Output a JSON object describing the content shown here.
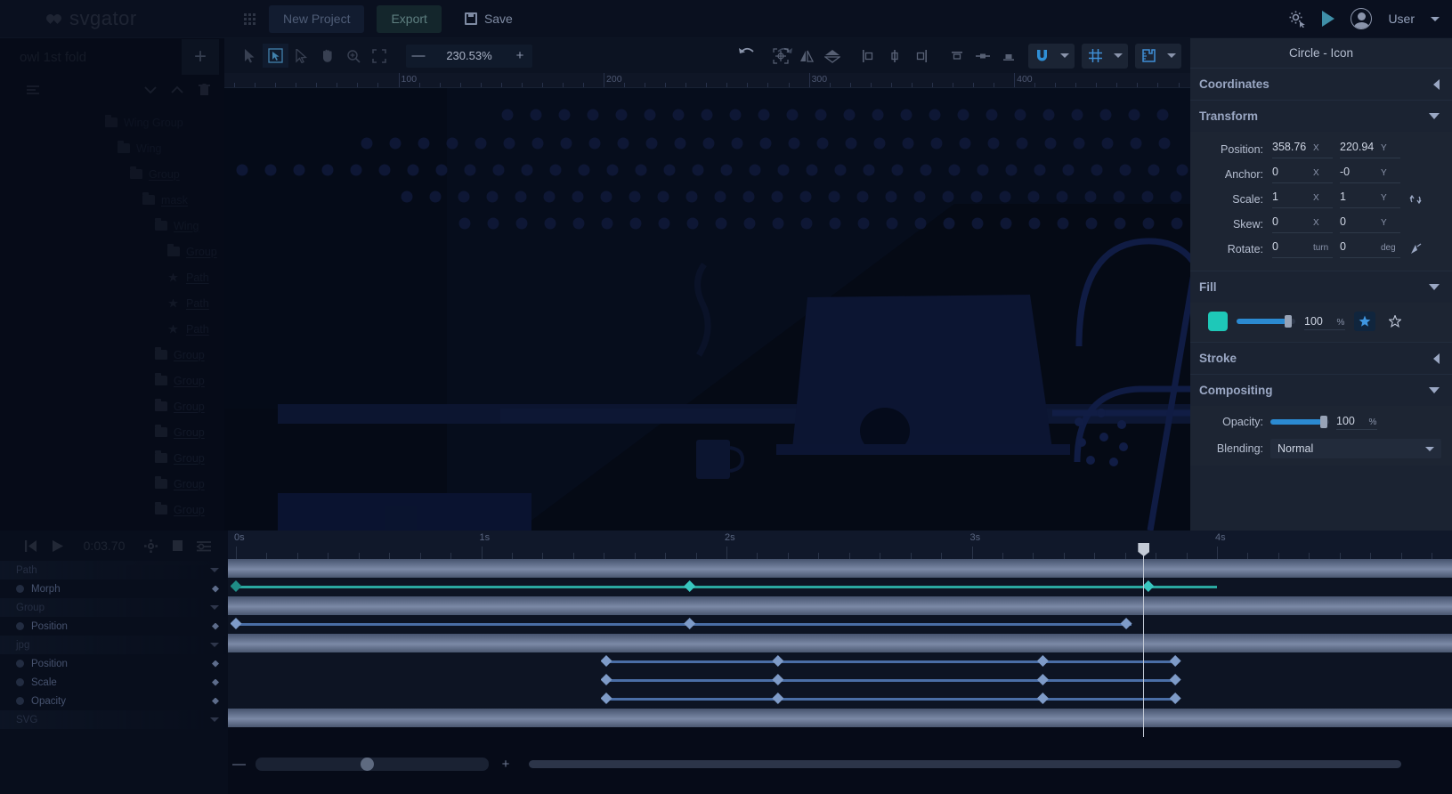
{
  "app": {
    "logo_text": "svgator",
    "new_project_label": "New Project",
    "export_label": "Export",
    "save_label": "Save",
    "user_label": "User"
  },
  "canvas_toolbar": {
    "zoom_value": "230.53%",
    "zoom_out": "—",
    "zoom_in": "+"
  },
  "ruler": {
    "labels": [
      "100",
      "200",
      "300",
      "400"
    ]
  },
  "layers": {
    "title": "owl 1st fold",
    "items": [
      {
        "label": "Wing Group",
        "icon": "folder-icon",
        "depth": 0,
        "underline": false
      },
      {
        "label": "Wing",
        "icon": "folder-icon",
        "depth": 1,
        "underline": false
      },
      {
        "label": "Group",
        "icon": "folder-icon",
        "depth": 2,
        "underline": true
      },
      {
        "label": "mask",
        "icon": "folder-icon",
        "depth": 3,
        "underline": true
      },
      {
        "label": "Wing",
        "icon": "folder-icon",
        "depth": 4,
        "underline": true
      },
      {
        "label": "Group",
        "icon": "folder-icon",
        "depth": 5,
        "underline": true
      },
      {
        "label": "Path",
        "icon": "path-icon",
        "depth": 5,
        "underline": true
      },
      {
        "label": "Path",
        "icon": "path-icon",
        "depth": 5,
        "underline": true
      },
      {
        "label": "Path",
        "icon": "path-icon",
        "depth": 5,
        "underline": true
      },
      {
        "label": "Group",
        "icon": "folder-icon",
        "depth": 4,
        "underline": true
      },
      {
        "label": "Group",
        "icon": "folder-icon",
        "depth": 4,
        "underline": true
      },
      {
        "label": "Group",
        "icon": "folder-icon",
        "depth": 4,
        "underline": true
      },
      {
        "label": "Group",
        "icon": "folder-icon",
        "depth": 4,
        "underline": true
      },
      {
        "label": "Group",
        "icon": "folder-icon",
        "depth": 4,
        "underline": true
      },
      {
        "label": "Group",
        "icon": "folder-icon",
        "depth": 4,
        "underline": true
      },
      {
        "label": "Group",
        "icon": "folder-icon",
        "depth": 4,
        "underline": true
      }
    ]
  },
  "properties": {
    "selection_title": "Circle - Icon",
    "sections": {
      "coordinates": "Coordinates",
      "transform": "Transform",
      "fill": "Fill",
      "stroke": "Stroke",
      "compositing": "Compositing"
    },
    "transform": {
      "position_label": "Position:",
      "position_x": "358.76",
      "position_y": "220.94",
      "anchor_label": "Anchor:",
      "anchor_x": "0",
      "anchor_y": "-0",
      "scale_label": "Scale:",
      "scale_x": "1",
      "scale_y": "1",
      "skew_label": "Skew:",
      "skew_x": "0",
      "skew_y": "0",
      "rotate_label": "Rotate:",
      "rotate_turn": "0",
      "rotate_deg": "0",
      "unit_x": "X",
      "unit_y": "Y",
      "unit_turn": "turn",
      "unit_deg": "deg"
    },
    "fill": {
      "color": "#1ec8b8",
      "opacity": "100",
      "unit": "%"
    },
    "compositing": {
      "opacity_label": "Opacity:",
      "opacity_value": "100",
      "opacity_unit": "%",
      "blending_label": "Blending:",
      "blending_value": "Normal"
    }
  },
  "timeline": {
    "current_time": "0:03.70",
    "ruler_labels": [
      "0s",
      "1s",
      "2s",
      "3s",
      "4s"
    ],
    "playhead_seconds": 3.7,
    "duration_seconds": 5.45,
    "rows": [
      {
        "type": "group",
        "label": "Path"
      },
      {
        "type": "prop",
        "label": "Morph",
        "color": "teal",
        "bar": [
          0.0,
          4.0
        ],
        "keys": [
          0.0,
          1.85,
          3.72
        ]
      },
      {
        "type": "group",
        "label": "Group"
      },
      {
        "type": "prop",
        "label": "Position",
        "color": "blue",
        "bar": [
          0.0,
          3.65
        ],
        "keys": [
          0.0,
          1.85,
          3.63
        ]
      },
      {
        "type": "group",
        "label": "jpg"
      },
      {
        "type": "prop",
        "label": "Position",
        "color": "blue",
        "bar": [
          1.51,
          3.83
        ],
        "keys": [
          1.51,
          2.21,
          3.29,
          3.83
        ]
      },
      {
        "type": "prop",
        "label": "Scale",
        "color": "blue",
        "bar": [
          1.51,
          3.83
        ],
        "keys": [
          1.51,
          2.21,
          3.29,
          3.83
        ]
      },
      {
        "type": "prop",
        "label": "Opacity",
        "color": "blue",
        "bar": [
          1.51,
          3.83
        ],
        "keys": [
          1.51,
          2.21,
          3.29,
          3.83
        ]
      },
      {
        "type": "group",
        "label": "SVG"
      }
    ],
    "zoom_out": "—",
    "zoom_in": "+"
  },
  "colors": {
    "accent_teal": "#39c6c0",
    "accent_blue": "#2b8ad1",
    "panel_bg": "#1b2332",
    "canvas_bg": "#060b18"
  }
}
